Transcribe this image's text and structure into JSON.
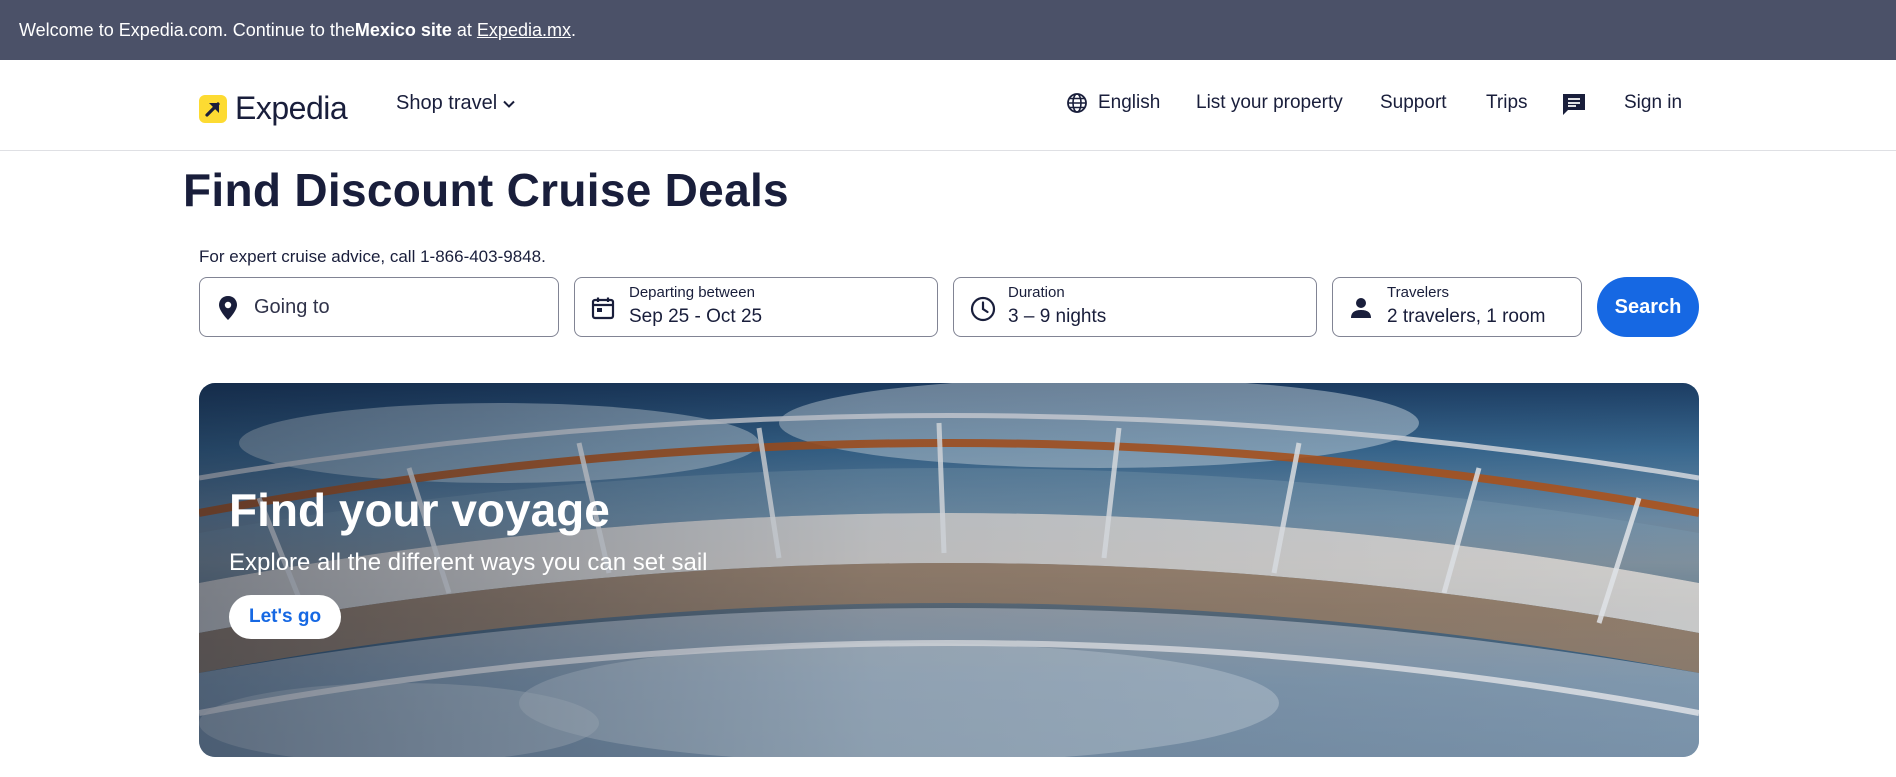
{
  "banner": {
    "prefix": "Welcome to Expedia.com. Continue to the ",
    "site_bold": "Mexico site",
    "at": " at ",
    "link": "Expedia.mx",
    "suffix": "."
  },
  "header": {
    "logo_text": "Expedia",
    "shop_travel": "Shop travel",
    "language": "English",
    "list_property": "List your property",
    "support": "Support",
    "trips": "Trips",
    "sign_in": "Sign in"
  },
  "main": {
    "title": "Find Discount Cruise Deals",
    "advice": "For expert cruise advice, call 1-866-403-9848."
  },
  "search": {
    "destination_placeholder": "Going to",
    "dates_label": "Departing between",
    "dates_value": "Sep 25 - Oct 25",
    "duration_label": "Duration",
    "duration_value": "3 – 9 nights",
    "travelers_label": "Travelers",
    "travelers_value": "2 travelers, 1 room",
    "search_button": "Search"
  },
  "hero": {
    "title": "Find your voyage",
    "subtitle": "Explore all the different ways you can set sail",
    "button": "Let's go"
  },
  "colors": {
    "banner_bg": "#4b5168",
    "text_dark": "#191e3b",
    "brand_yellow": "#fddb32",
    "accent_blue": "#1668e3"
  }
}
